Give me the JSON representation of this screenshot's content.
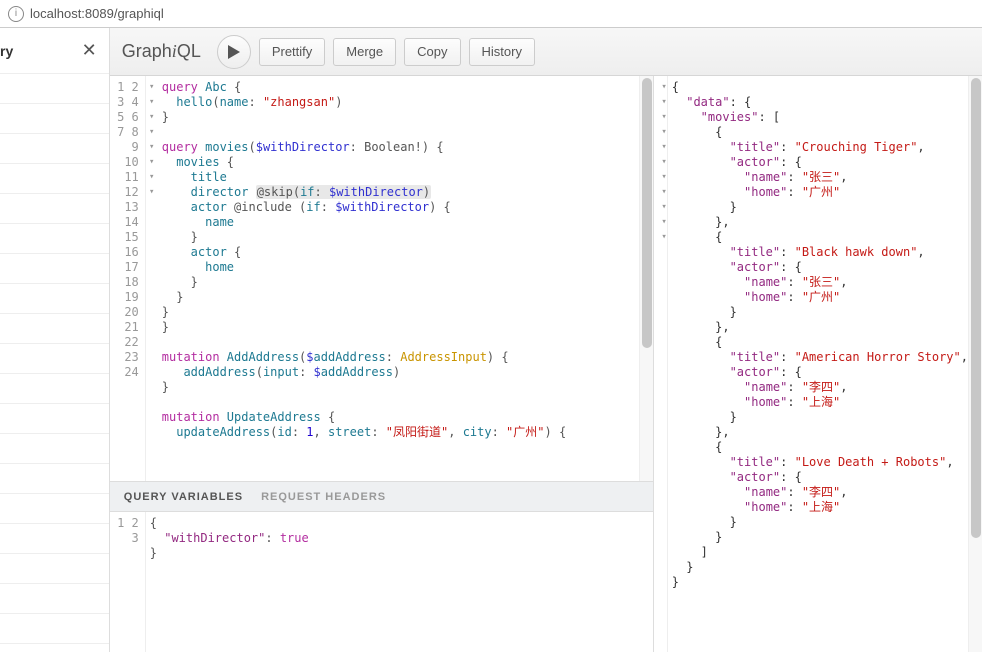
{
  "address": {
    "url": "localhost:8089/graphiql"
  },
  "leftPanel": {
    "title": "ry",
    "close": "✕"
  },
  "toolbar": {
    "logo_pre": "Graph",
    "logo_i": "i",
    "logo_post": "QL",
    "prettify": "Prettify",
    "merge": "Merge",
    "copy": "Copy",
    "history": "History"
  },
  "editor": {
    "lines": [
      "query Abc {",
      "  hello(name: \"zhangsan\")",
      "}",
      "",
      "query movies($withDirector: Boolean!) {",
      "  movies {",
      "    title",
      "    director @skip(if: $withDirector)",
      "    actor @include (if: $withDirector) {",
      "      name",
      "    }",
      "    actor {",
      "      home",
      "    }",
      "  }",
      "}",
      "}",
      "",
      "mutation AddAddress($addAddress: AddressInput) {",
      "   addAddress(input: $addAddress)",
      "}",
      "",
      "mutation UpdateAddress {",
      "  updateAddress(id: 1, street: \"凤阳街道\", city: \"广州\") {"
    ],
    "fold_markers": {
      "1": "▾",
      "5": "▾",
      "6": "▾",
      "9": "▾",
      "12": "▾",
      "19": "▾",
      "23": "▾",
      "24": "▾"
    }
  },
  "varsPane": {
    "tab_vars": "QUERY VARIABLES",
    "tab_headers": "REQUEST HEADERS",
    "lines": [
      "{",
      "  \"withDirector\": true",
      "}"
    ]
  },
  "result": {
    "data": {
      "movies": [
        {
          "title": "Crouching Tiger",
          "actor": {
            "name": "张三",
            "home": "广州"
          }
        },
        {
          "title": "Black hawk down",
          "actor": {
            "name": "张三",
            "home": "广州"
          }
        },
        {
          "title": "American Horror Story",
          "actor": {
            "name": "李四",
            "home": "上海"
          }
        },
        {
          "title": "Love Death + Robots",
          "actor": {
            "name": "李四",
            "home": "上海"
          }
        }
      ]
    }
  }
}
